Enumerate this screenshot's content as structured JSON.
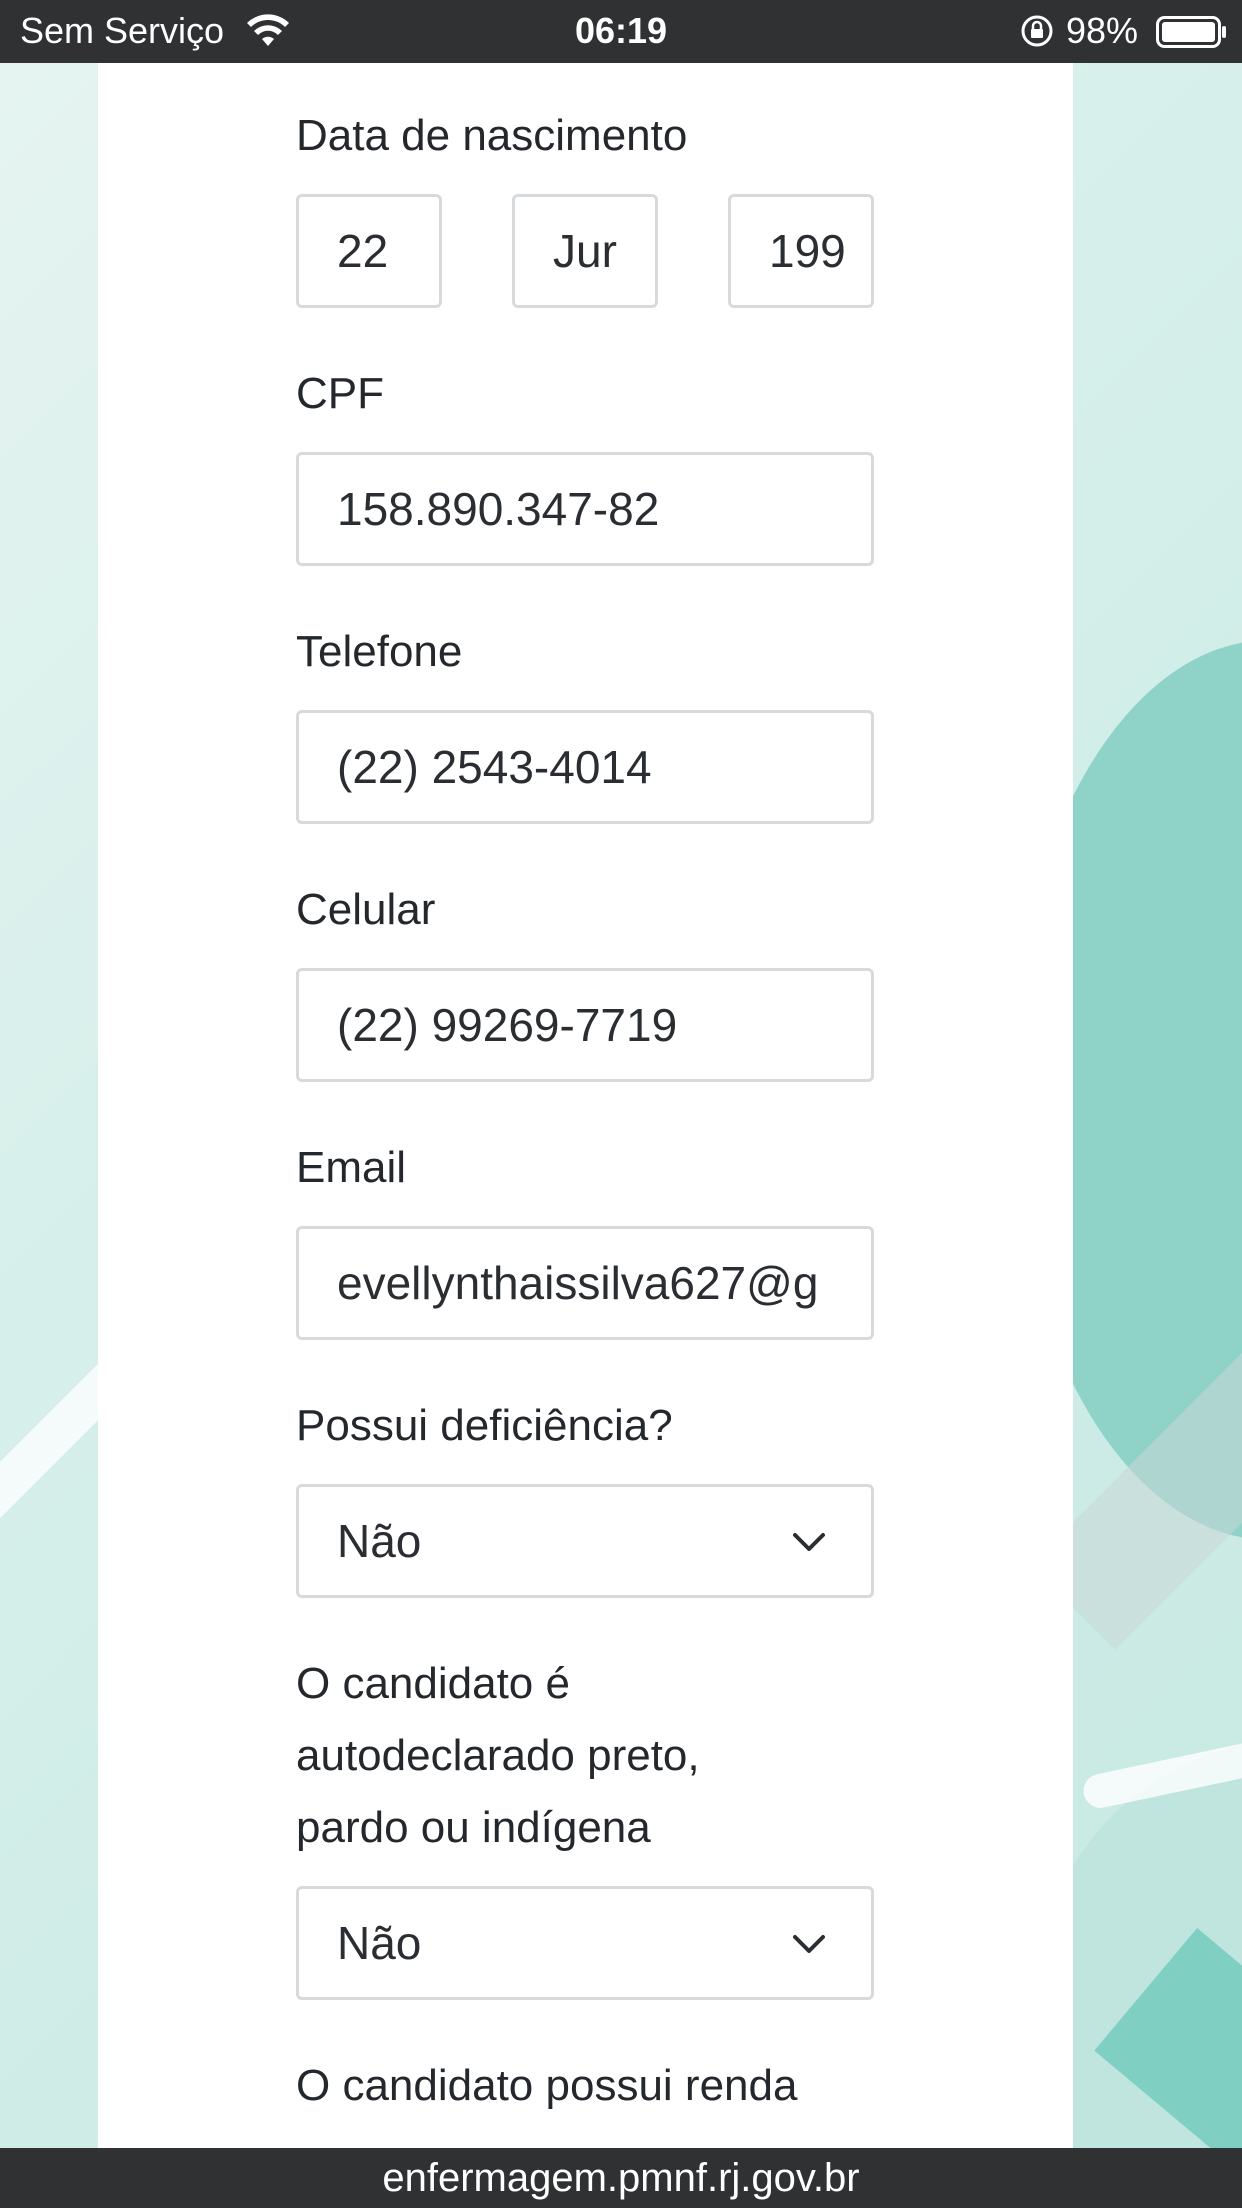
{
  "status_bar": {
    "carrier": "Sem Serviço",
    "time": "06:19",
    "battery": "98%"
  },
  "form": {
    "birth_date": {
      "label": "Data de nascimento",
      "day": "22",
      "month": "Jur",
      "year": "199"
    },
    "cpf": {
      "label": "CPF",
      "value": "158.890.347-82"
    },
    "phone": {
      "label": "Telefone",
      "value": "(22) 2543-4014"
    },
    "mobile": {
      "label": "Celular",
      "value": "(22) 99269-7719"
    },
    "email": {
      "label": "Email",
      "value": "evellynthaissilva627@g"
    },
    "disability": {
      "label": "Possui deficiência?",
      "selected": "Não"
    },
    "race": {
      "label_line1": "O candidato é",
      "label_line2": "autodeclarado preto,",
      "label_line3": "pardo ou indígena",
      "selected": "Não"
    },
    "income": {
      "label": "O candidato possui renda"
    }
  },
  "url_bar": {
    "url": "enfermagem.pmnf.rj.gov.br"
  },
  "colors": {
    "status_bar": "#2f3133",
    "panel": "#ffffff",
    "background_teal": "#8fd3c8",
    "input_border": "#d7dadd"
  }
}
